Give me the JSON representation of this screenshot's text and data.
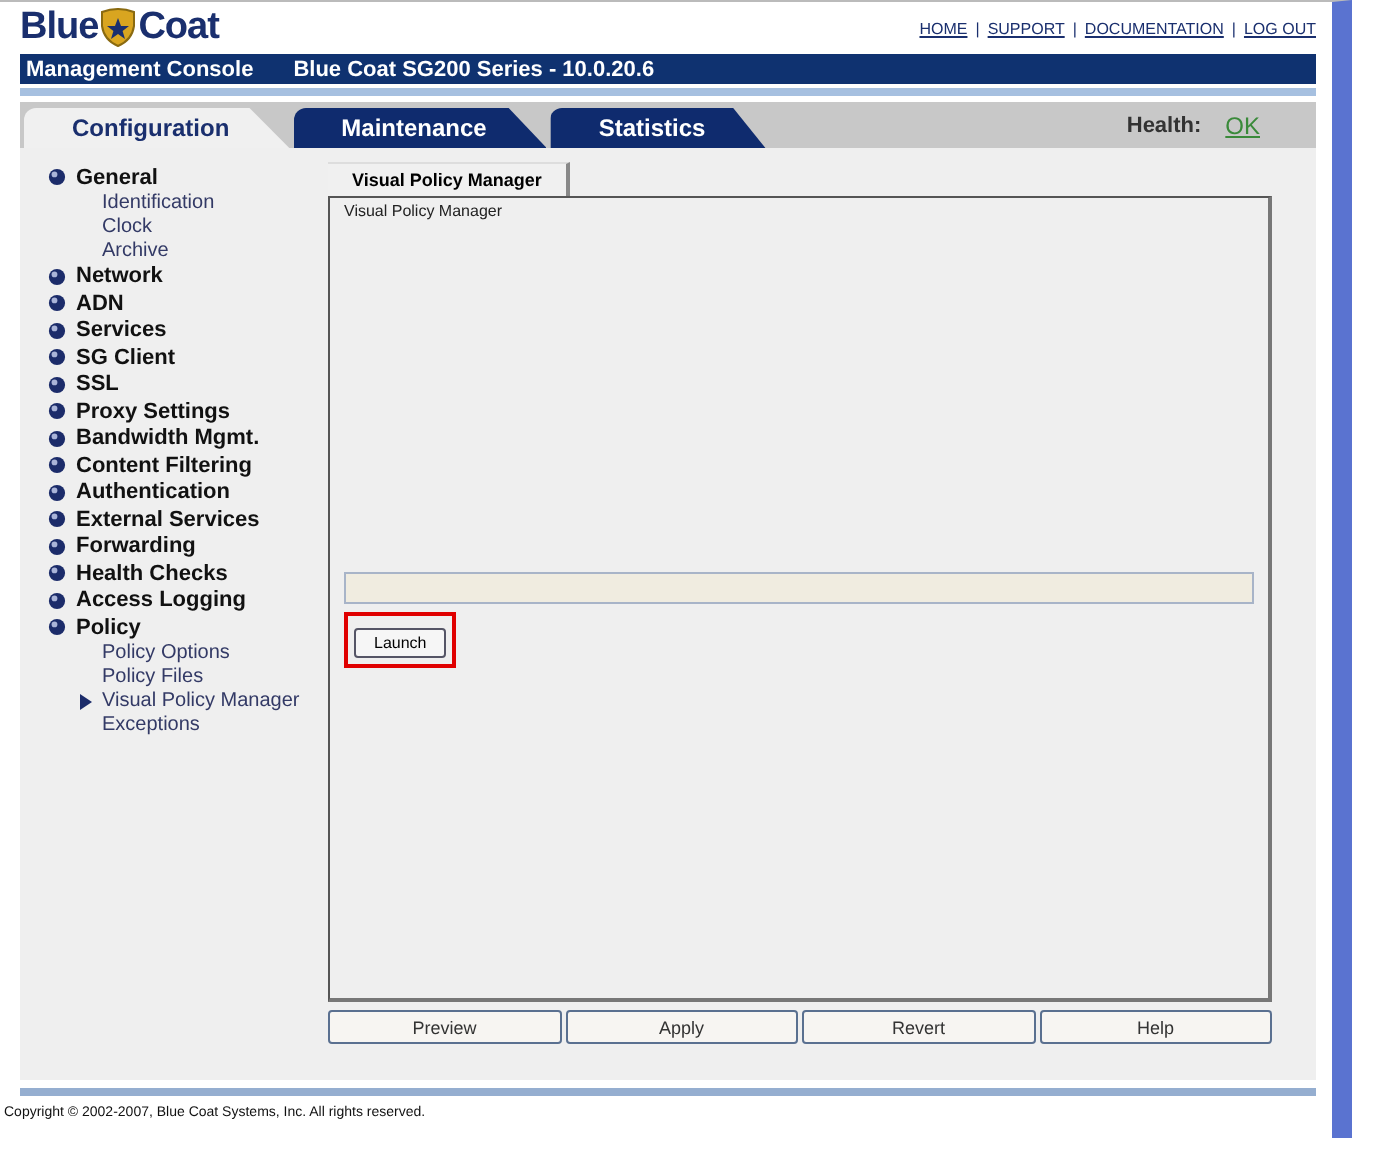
{
  "logo": {
    "left": "Blue",
    "right": "Coat"
  },
  "top_links": [
    "HOME",
    "SUPPORT",
    "DOCUMENTATION",
    "LOG OUT"
  ],
  "link_separator": "|",
  "title_bar": {
    "product": "Management Console",
    "model": "Blue Coat SG200 Series - 10.0.20.6"
  },
  "tabs": [
    {
      "label": "Configuration",
      "selected": true
    },
    {
      "label": "Maintenance",
      "selected": false
    },
    {
      "label": "Statistics",
      "selected": false
    }
  ],
  "health": {
    "label": "Health:",
    "value": "OK"
  },
  "sidebar": {
    "items": [
      {
        "label": "General",
        "children": [
          {
            "label": "Identification",
            "selected": false
          },
          {
            "label": "Clock",
            "selected": false
          },
          {
            "label": "Archive",
            "selected": false
          }
        ]
      },
      {
        "label": "Network"
      },
      {
        "label": "ADN"
      },
      {
        "label": "Services"
      },
      {
        "label": "SG Client"
      },
      {
        "label": "SSL"
      },
      {
        "label": "Proxy Settings"
      },
      {
        "label": "Bandwidth Mgmt."
      },
      {
        "label": "Content Filtering"
      },
      {
        "label": "Authentication"
      },
      {
        "label": "External Services"
      },
      {
        "label": "Forwarding"
      },
      {
        "label": "Health Checks"
      },
      {
        "label": "Access Logging"
      },
      {
        "label": "Policy",
        "children": [
          {
            "label": "Policy Options",
            "selected": false
          },
          {
            "label": "Policy Files",
            "selected": false
          },
          {
            "label": "Visual Policy Manager",
            "selected": true
          },
          {
            "label": "Exceptions",
            "selected": false
          }
        ]
      }
    ]
  },
  "panel": {
    "tab": "Visual Policy Manager",
    "heading": "Visual Policy Manager",
    "launch_button": "Launch"
  },
  "buttons": [
    "Preview",
    "Apply",
    "Revert",
    "Help"
  ],
  "copyright": "Copyright © 2002-2007, Blue Coat Systems, Inc. All rights reserved."
}
